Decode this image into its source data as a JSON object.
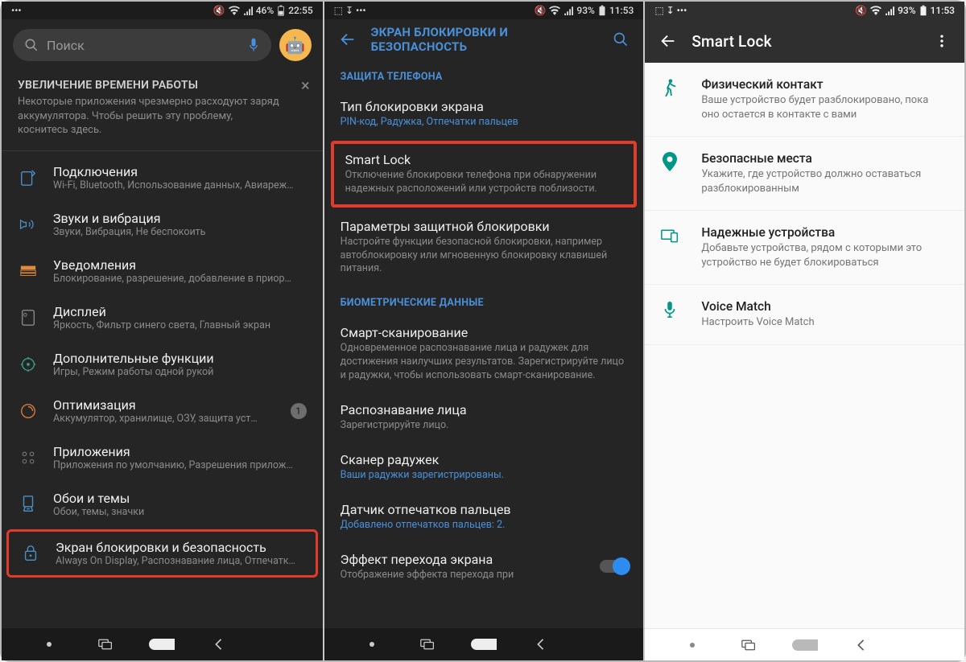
{
  "phone1": {
    "status": {
      "left": "•••",
      "battery": "46%",
      "time": "22:55"
    },
    "search_placeholder": "Поиск",
    "tip": {
      "title": "УВЕЛИЧЕНИЕ ВРЕМЕНИ РАБОТЫ",
      "text": "Некоторые приложения чрезмерно расходуют заряд аккумулятора. Чтобы решить эту проблему, коснитесь здесь."
    },
    "items": [
      {
        "title": "Подключения",
        "sub": "Wi-Fi, Bluetooth, Использование данных, Авиареж…"
      },
      {
        "title": "Звуки и вибрация",
        "sub": "Звуки, Вибрация, Не беспокоить"
      },
      {
        "title": "Уведомления",
        "sub": "Блокирование, разрешение, добавление в приор…"
      },
      {
        "title": "Дисплей",
        "sub": "Яркость, Фильтр синего света, Главный экран"
      },
      {
        "title": "Дополнительные функции",
        "sub": "Игры, Режим работы одной рукой"
      },
      {
        "title": "Оптимизация",
        "sub": "Аккумулятор, хранилище, ОЗУ, защита уст…",
        "badge": "1"
      },
      {
        "title": "Приложения",
        "sub": "Приложения по умолчанию, Разрешения прилож…"
      },
      {
        "title": "Обои и темы",
        "sub": "Обои, темы, значки"
      },
      {
        "title": "Экран блокировки и безопасность",
        "sub": "Always On Display, Распознавание лица, Отпечатк…",
        "highlight": true
      }
    ]
  },
  "phone2": {
    "status": {
      "left_icons": "⬚ ↧ •••",
      "battery": "93%",
      "time": "11:53"
    },
    "appbar_title": "ЭКРАН БЛОКИРОВКИ И БЕЗОПАСНОСТЬ",
    "sections": [
      {
        "header": "ЗАЩИТА ТЕЛЕФОНА",
        "items": [
          {
            "title": "Тип блокировки экрана",
            "sub": "PIN-код, Радужка, Отпечатки пальцев",
            "sub_blue": true
          },
          {
            "title": "Smart Lock",
            "sub": "Отключение блокировки телефона при обнаружении надежных расположений или устройств поблизости.",
            "highlight": true
          },
          {
            "title": "Параметры защитной блокировки",
            "sub": "Настройте функции безопасной блокировки, например автоблокировку или мгновенную блокировку клавишей питания."
          }
        ]
      },
      {
        "header": "БИОМЕТРИЧЕСКИЕ ДАННЫЕ",
        "items": [
          {
            "title": "Смарт-сканирование",
            "sub": "Одновременное распознавание лица и радужек для достижения наилучших результатов. Зарегистрируйте лицо и радужки, чтобы использовать смарт-сканирование."
          },
          {
            "title": "Распознавание лица",
            "sub": "Зарегистрируйте лицо."
          },
          {
            "title": "Сканер радужек",
            "sub": "Ваши радужки зарегистрированы.",
            "sub_blue": true
          },
          {
            "title": "Датчик отпечатков пальцев",
            "sub": "Добавлено отпечатков пальцев: 2.",
            "sub_blue": true
          },
          {
            "title": "Эффект перехода экрана",
            "sub": "Отображение эффекта перехода при",
            "toggle": true
          }
        ]
      }
    ]
  },
  "phone3": {
    "status": {
      "left_icons": "⬚ ↧ •••",
      "battery": "93%",
      "time": "11:53"
    },
    "appbar_title": "Smart Lock",
    "items": [
      {
        "icon": "walk",
        "title": "Физический контакт",
        "sub": "Ваше устройство будет разблокировано, пока оно остается в контакте с вами"
      },
      {
        "icon": "place",
        "title": "Безопасные места",
        "sub": "Укажите, где устройство должно оставаться разблокированным"
      },
      {
        "icon": "devices",
        "title": "Надежные устройства",
        "sub": "Добавьте устройства, рядом с которыми это устройство не будет блокироваться"
      },
      {
        "icon": "mic",
        "title": "Voice Match",
        "sub": "Настроить Voice Match"
      }
    ]
  }
}
